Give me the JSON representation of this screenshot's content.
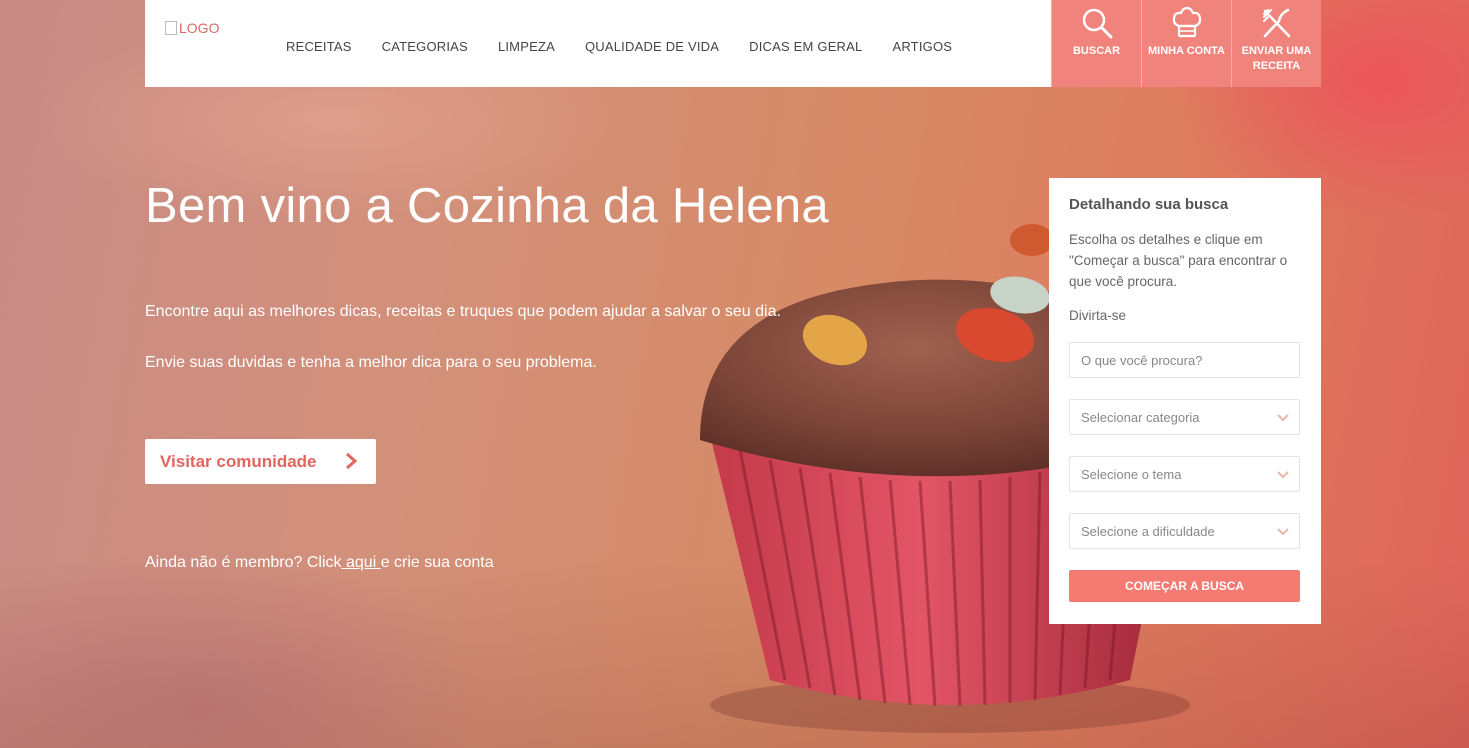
{
  "brand": {
    "logo_alt": "LOGO",
    "accent_color": "#f0847c",
    "button_color": "#f47a72",
    "link_color": "#e2655f"
  },
  "nav": {
    "items": [
      {
        "label": "RECEITAS"
      },
      {
        "label": "CATEGORIAS"
      },
      {
        "label": "LIMPEZA"
      },
      {
        "label": "QUALIDADE DE VIDA"
      },
      {
        "label": "DICAS EM GERAL"
      },
      {
        "label": "ARTIGOS"
      }
    ]
  },
  "actions": [
    {
      "label": "BUSCAR",
      "icon": "search-icon"
    },
    {
      "label": "MINHA CONTA",
      "icon": "chef-hat-icon"
    },
    {
      "label": "ENVIAR UMA RECEITA",
      "icon": "fork-knife-icon"
    }
  ],
  "hero": {
    "title": "Bem vino a Cozinha da Helena",
    "paragraph1": "Encontre aqui as melhores dicas, receitas e truques que podem ajudar a salvar o seu dia.",
    "paragraph2": "Envie suas duvidas e tenha a melhor dica para o seu problema.",
    "cta_label": "Visitar comunidade",
    "member_prefix": "Ainda não é membro? Click",
    "member_link": " aqui ",
    "member_suffix": "e crie sua conta"
  },
  "search_panel": {
    "title": "Detalhando sua busca",
    "description": "Escolha os detalhes e clique em \"Começar a busca\" para encontrar o que você procura.",
    "subtitle": "Divirta-se",
    "query_placeholder": "O que você procura?",
    "category_select": "Selecionar categoria",
    "theme_select": "Selecione o tema",
    "difficulty_select": "Selecione a dificuldade",
    "submit_label": "COMEÇAR A BUSCA"
  }
}
